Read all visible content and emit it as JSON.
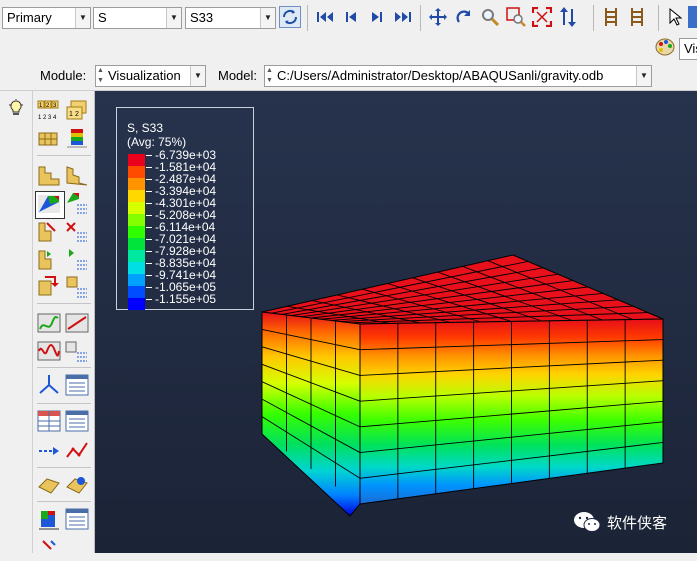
{
  "toolbar": {
    "step_combo": "Primary",
    "variable_combo": "S",
    "component_combo": "S33"
  },
  "toolbar2": {
    "vis_label": "Vis"
  },
  "context": {
    "module_label": "Module:",
    "module_value": "Visualization",
    "model_label": "Model:",
    "model_value": "C:/Users/Administrator/Desktop/ABAQUSanli/gravity.odb"
  },
  "legend": {
    "title": "S, S33",
    "subtitle": "(Avg: 75%)",
    "entries": [
      {
        "value": "-6.739e+03",
        "color": "#e8001c"
      },
      {
        "value": "-1.581e+04",
        "color": "#ff4b00"
      },
      {
        "value": "-2.487e+04",
        "color": "#ff9400"
      },
      {
        "value": "-3.394e+04",
        "color": "#ffd800"
      },
      {
        "value": "-4.301e+04",
        "color": "#d6ff00"
      },
      {
        "value": "-5.208e+04",
        "color": "#84ff00"
      },
      {
        "value": "-6.114e+04",
        "color": "#2fff00"
      },
      {
        "value": "-7.021e+04",
        "color": "#00e43c"
      },
      {
        "value": "-7.928e+04",
        "color": "#00e7a0"
      },
      {
        "value": "-8.835e+04",
        "color": "#00dfe4"
      },
      {
        "value": "-9.741e+04",
        "color": "#00a0ff"
      },
      {
        "value": "-1.065e+05",
        "color": "#004dff"
      },
      {
        "value": "-1.155e+05",
        "color": "#0000ff"
      }
    ]
  },
  "watermark": {
    "text": "软件侠客"
  },
  "colors": {
    "viewport_bg": "#1f2a40",
    "accent": "#2b62c9"
  }
}
